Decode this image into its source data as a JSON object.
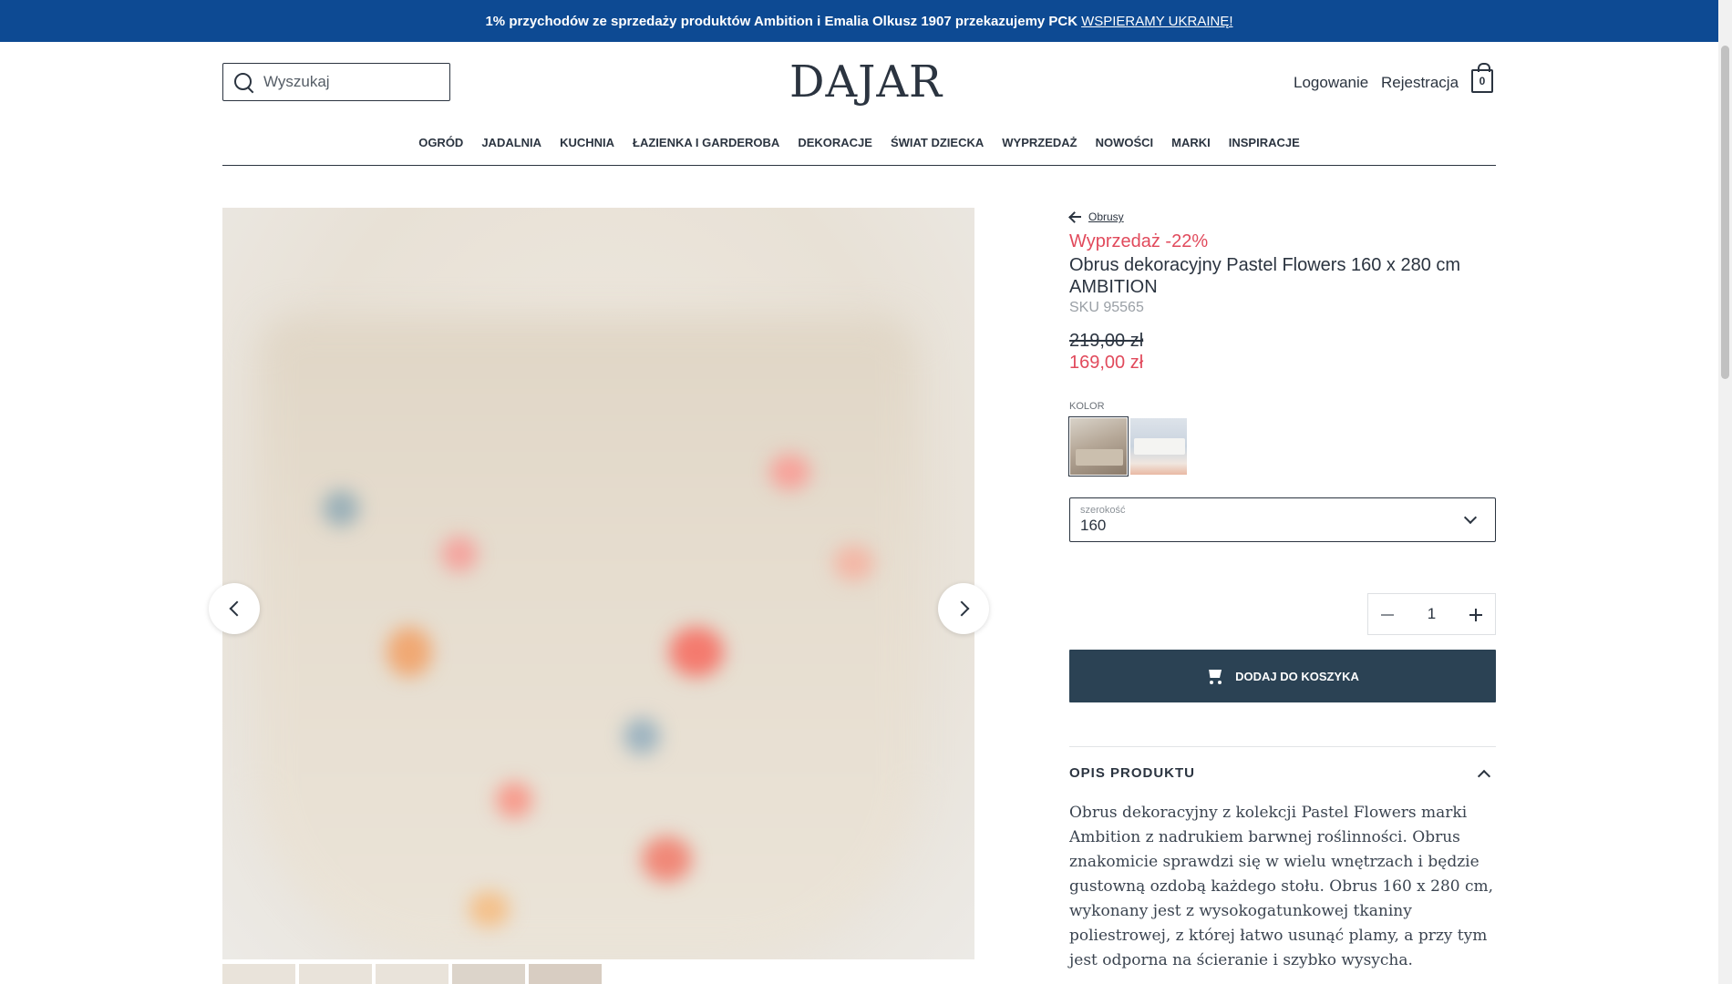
{
  "promo": {
    "text": "1% przychodów ze sprzedaży produktów Ambition i Emalia Olkusz 1907 przekazujemy PCK",
    "link": "WSPIERAMY UKRAINĘ!"
  },
  "header": {
    "search_placeholder": "Wyszukaj",
    "logo": "DAJAR",
    "login": "Logowanie",
    "register": "Rejestracja",
    "cart_count": "0"
  },
  "nav": {
    "items": [
      "OGRÓD",
      "JADALNIA",
      "KUCHNIA",
      "ŁAZIENKA I GARDEROBA",
      "DEKORACJE",
      "ŚWIAT DZIECKA",
      "WYPRZEDAŻ",
      "NOWOŚCI",
      "MARKI",
      "INSPIRACJE"
    ]
  },
  "product": {
    "breadcrumb": "Obrusy",
    "sale_label": "Wyprzedaż -22%",
    "title": "Obrus dekoracyjny Pastel Flowers 160 x 280 cm AMBITION",
    "sku": "SKU 95565",
    "old_price": "219,00 zł",
    "new_price": "169,00 zł",
    "color_label": "KOLOR",
    "width_label": "szerokość",
    "width_value": "160",
    "quantity": "1",
    "add_to_cart": "DODAJ DO KOSZYKA",
    "description_title": "OPIS PRODUKTU",
    "description": "Obrus dekoracyjny z kolekcji Pastel Flowers marki Ambition z nadrukiem barwnej roślinności. Obrus znakomicie sprawdzi się w wielu wnętrzach i będzie gustowną ozdobą każdego stołu. Obrus 160 x 280 cm, wykonany jest z wysokogatunkowej tkaniny poliestrowej, z której łatwo usunąć plamy, a przy tym jest odporna na ścieranie i szybko wysycha."
  },
  "colors": {
    "accent": "#0d4a93",
    "sale": "#e14a5c",
    "button": "#2b4254"
  }
}
